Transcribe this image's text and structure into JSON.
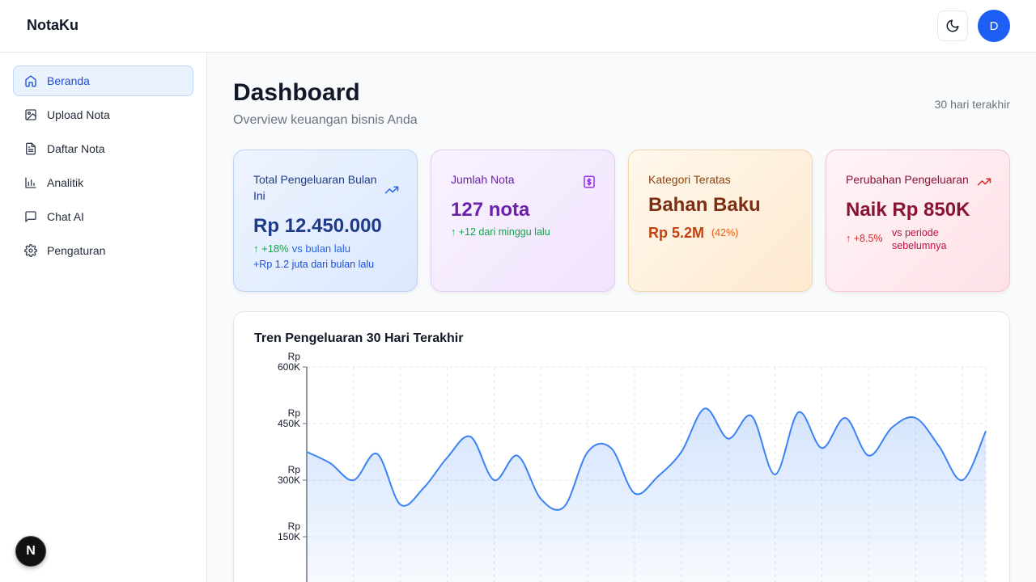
{
  "app": {
    "brand": "NotaKu",
    "avatar_initial": "D"
  },
  "sidebar": {
    "items": [
      {
        "label": "Beranda",
        "icon": "home-icon",
        "active": true
      },
      {
        "label": "Upload Nota",
        "icon": "image-icon"
      },
      {
        "label": "Daftar Nota",
        "icon": "file-text-icon"
      },
      {
        "label": "Analitik",
        "icon": "bar-chart-icon"
      },
      {
        "label": "Chat AI",
        "icon": "message-square-icon"
      },
      {
        "label": "Pengaturan",
        "icon": "gear-icon"
      }
    ],
    "badge_letter": "N"
  },
  "header": {
    "title": "Dashboard",
    "subtitle": "Overview keuangan bisnis Anda",
    "range": "30 hari terakhir"
  },
  "cards": {
    "total": {
      "label": "Total Pengeluaran Bulan Ini",
      "value": "Rp 12.450.000",
      "trend": "↑ +18%",
      "trend_suffix": "vs bulan lalu",
      "note": "+Rp 1.2 juta dari bulan lalu",
      "icon": "trending-up-icon"
    },
    "count": {
      "label": "Jumlah Nota",
      "value": "127 nota",
      "trend": "↑ +12 dari minggu lalu",
      "icon": "dollar-receipt-icon"
    },
    "category": {
      "label": "Kategori Teratas",
      "value": "Bahan Baku",
      "amount": "Rp 5.2M",
      "percent": "(42%)"
    },
    "change": {
      "label": "Perubahan Pengeluaran",
      "value": "Naik Rp 850K",
      "trend": "↑ +8.5%",
      "trend_suffix": "vs periode sebelumnya",
      "icon": "trending-up-icon"
    }
  },
  "colors": {
    "accent": "#1d5ff5",
    "line": "#3b82f6"
  },
  "chart_data": {
    "type": "area",
    "title": "Tren Pengeluaran 30 Hari Terakhir",
    "xlabel": "",
    "ylabel": "",
    "ylim": [
      0,
      600000
    ],
    "y_ticks": [
      {
        "value": 600000,
        "line1": "Rp",
        "line2": "600K"
      },
      {
        "value": 450000,
        "line1": "Rp",
        "line2": "450K"
      },
      {
        "value": 300000,
        "line1": "Rp",
        "line2": "300K"
      },
      {
        "value": 150000,
        "line1": "Rp",
        "line2": "150K"
      }
    ],
    "grid": true,
    "series": [
      {
        "values": [
          375000,
          345000,
          300000,
          370000,
          235000,
          280000,
          360000,
          415000,
          300000,
          365000,
          250000,
          230000,
          375000,
          385000,
          265000,
          310000,
          375000,
          490000,
          410000,
          470000,
          315000,
          480000,
          385000,
          465000,
          365000,
          440000,
          465000,
          390000,
          300000,
          430000
        ]
      }
    ]
  }
}
